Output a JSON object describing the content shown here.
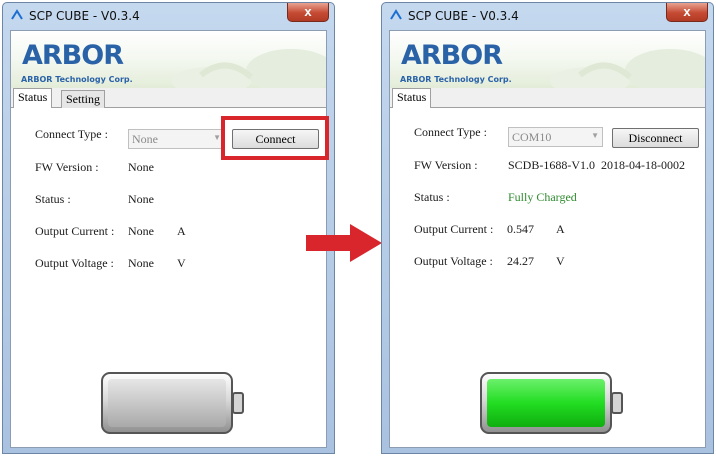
{
  "colors": {
    "highlight": "#d9262c",
    "arrow": "#d9262c",
    "status_ok": "#2e8b2e",
    "battery_empty": "#c8c8c8",
    "battery_full": "#22dd22"
  },
  "windows": [
    {
      "title": "SCP CUBE - V0.3.4",
      "close_glyph": "x",
      "logo": {
        "name": "ARBOR",
        "subtitle": "ARBOR Technology Corp."
      },
      "tabs": [
        "Status",
        "Setting"
      ],
      "connect_type_label": "Connect Type :",
      "connect_type_value": "None",
      "button_label": "Connect",
      "fw_label": "FW Version :",
      "fw_value": "None",
      "status_label": "Status :",
      "status_value": "None",
      "current_label": "Output Current :",
      "current_value": "None",
      "current_unit": "A",
      "voltage_label": "Output Voltage :",
      "voltage_value": "None",
      "voltage_unit": "V",
      "battery_level": 0
    },
    {
      "title": "SCP CUBE - V0.3.4",
      "close_glyph": "x",
      "logo": {
        "name": "ARBOR",
        "subtitle": "ARBOR Technology Corp."
      },
      "tabs": [
        "Status"
      ],
      "connect_type_label": "Connect Type :",
      "connect_type_value": "COM10",
      "button_label": "Disconnect",
      "fw_label": "FW Version :",
      "fw_value": "SCDB-1688-V1.0  2018-04-18-0002",
      "status_label": "Status :",
      "status_value": "Fully Charged",
      "current_label": "Output Current :",
      "current_value": "0.547",
      "current_unit": "A",
      "voltage_label": "Output Voltage :",
      "voltage_value": "24.27",
      "voltage_unit": "V",
      "battery_level": 1
    }
  ]
}
